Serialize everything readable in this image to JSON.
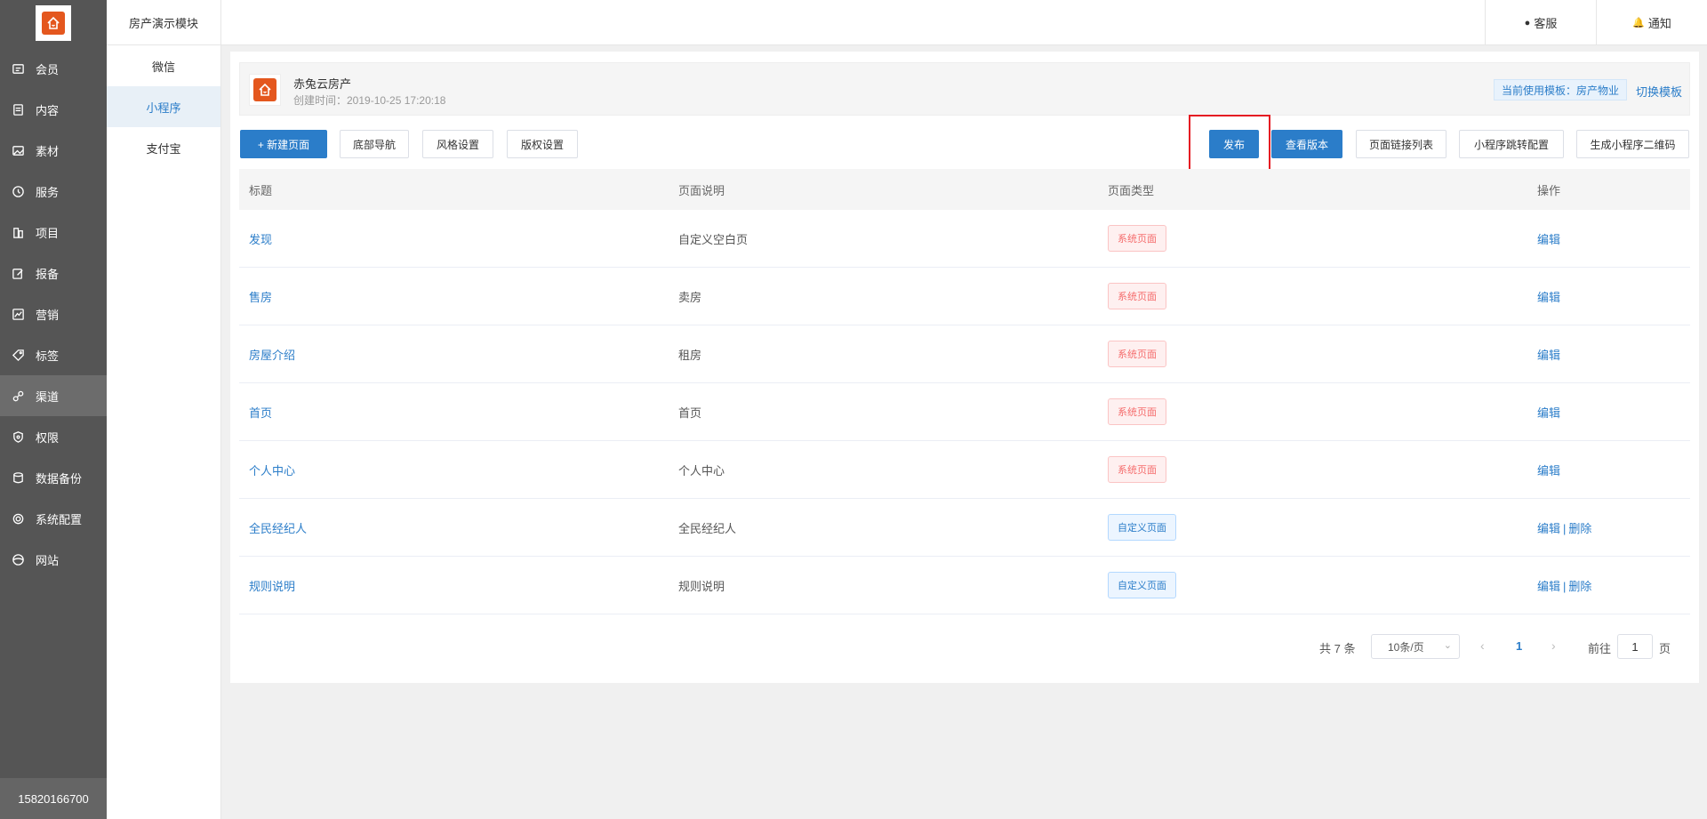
{
  "sidebar": {
    "items": [
      {
        "label": "会员",
        "icon": "member-card-icon"
      },
      {
        "label": "内容",
        "icon": "document-icon"
      },
      {
        "label": "素材",
        "icon": "image-icon"
      },
      {
        "label": "服务",
        "icon": "clock-icon"
      },
      {
        "label": "项目",
        "icon": "building-icon"
      },
      {
        "label": "报备",
        "icon": "edit-icon"
      },
      {
        "label": "营销",
        "icon": "chart-icon"
      },
      {
        "label": "标签",
        "icon": "tag-icon"
      },
      {
        "label": "渠道",
        "icon": "channel-icon"
      },
      {
        "label": "权限",
        "icon": "shield-icon"
      },
      {
        "label": "数据备份",
        "icon": "database-icon"
      },
      {
        "label": "系统配置",
        "icon": "gear-icon"
      },
      {
        "label": "网站",
        "icon": "globe-icon"
      }
    ],
    "active_index": 8,
    "account": "15820166700"
  },
  "submenu": {
    "title": "房产演示模块",
    "items": [
      "微信",
      "小程序",
      "支付宝"
    ],
    "active_index": 1
  },
  "topbar": {
    "service_label": "客服",
    "notify_label": "通知"
  },
  "app": {
    "name": "赤兔云房产",
    "created": "创建时间：2019-10-25 17:20:18",
    "template": "当前使用模板：房产物业",
    "switch_template": "切换模板"
  },
  "toolbar": {
    "new_page": "+ 新建页面",
    "bottom_nav": "底部导航",
    "style_settings": "风格设置",
    "copyright_settings": "版权设置",
    "publish": "发布",
    "view_version": "查看版本",
    "page_links": "页面链接列表",
    "mini_jump": "小程序跳转配置",
    "gen_qrcode": "生成小程序二维码"
  },
  "table": {
    "headers": [
      "标题",
      "页面说明",
      "页面类型",
      "操作"
    ],
    "rows": [
      {
        "title": "发现",
        "desc": "自定义空白页",
        "type": "系统页面",
        "type_kind": "sys",
        "edit": "编辑",
        "delete": ""
      },
      {
        "title": "售房",
        "desc": "卖房",
        "type": "系统页面",
        "type_kind": "sys",
        "edit": "编辑",
        "delete": ""
      },
      {
        "title": "房屋介绍",
        "desc": "租房",
        "type": "系统页面",
        "type_kind": "sys",
        "edit": "编辑",
        "delete": ""
      },
      {
        "title": "首页",
        "desc": "首页",
        "type": "系统页面",
        "type_kind": "sys",
        "edit": "编辑",
        "delete": ""
      },
      {
        "title": "个人中心",
        "desc": "个人中心",
        "type": "系统页面",
        "type_kind": "sys",
        "edit": "编辑",
        "delete": ""
      },
      {
        "title": "全民经纪人",
        "desc": "全民经纪人",
        "type": "自定义页面",
        "type_kind": "custom",
        "edit": "编辑",
        "delete": "删除"
      },
      {
        "title": "规则说明",
        "desc": "规则说明",
        "type": "自定义页面",
        "type_kind": "custom",
        "edit": "编辑",
        "delete": "删除"
      }
    ]
  },
  "pagination": {
    "total": "共 7 条",
    "page_size": "10条/页",
    "current": "1",
    "goto_label": "前往",
    "goto_value": "1",
    "page_suffix": "页"
  },
  "colors": {
    "primary": "#2b7dc9",
    "sidebar_bg": "#555555",
    "highlight": "#e51c23",
    "logo_orange": "#e4571e"
  }
}
